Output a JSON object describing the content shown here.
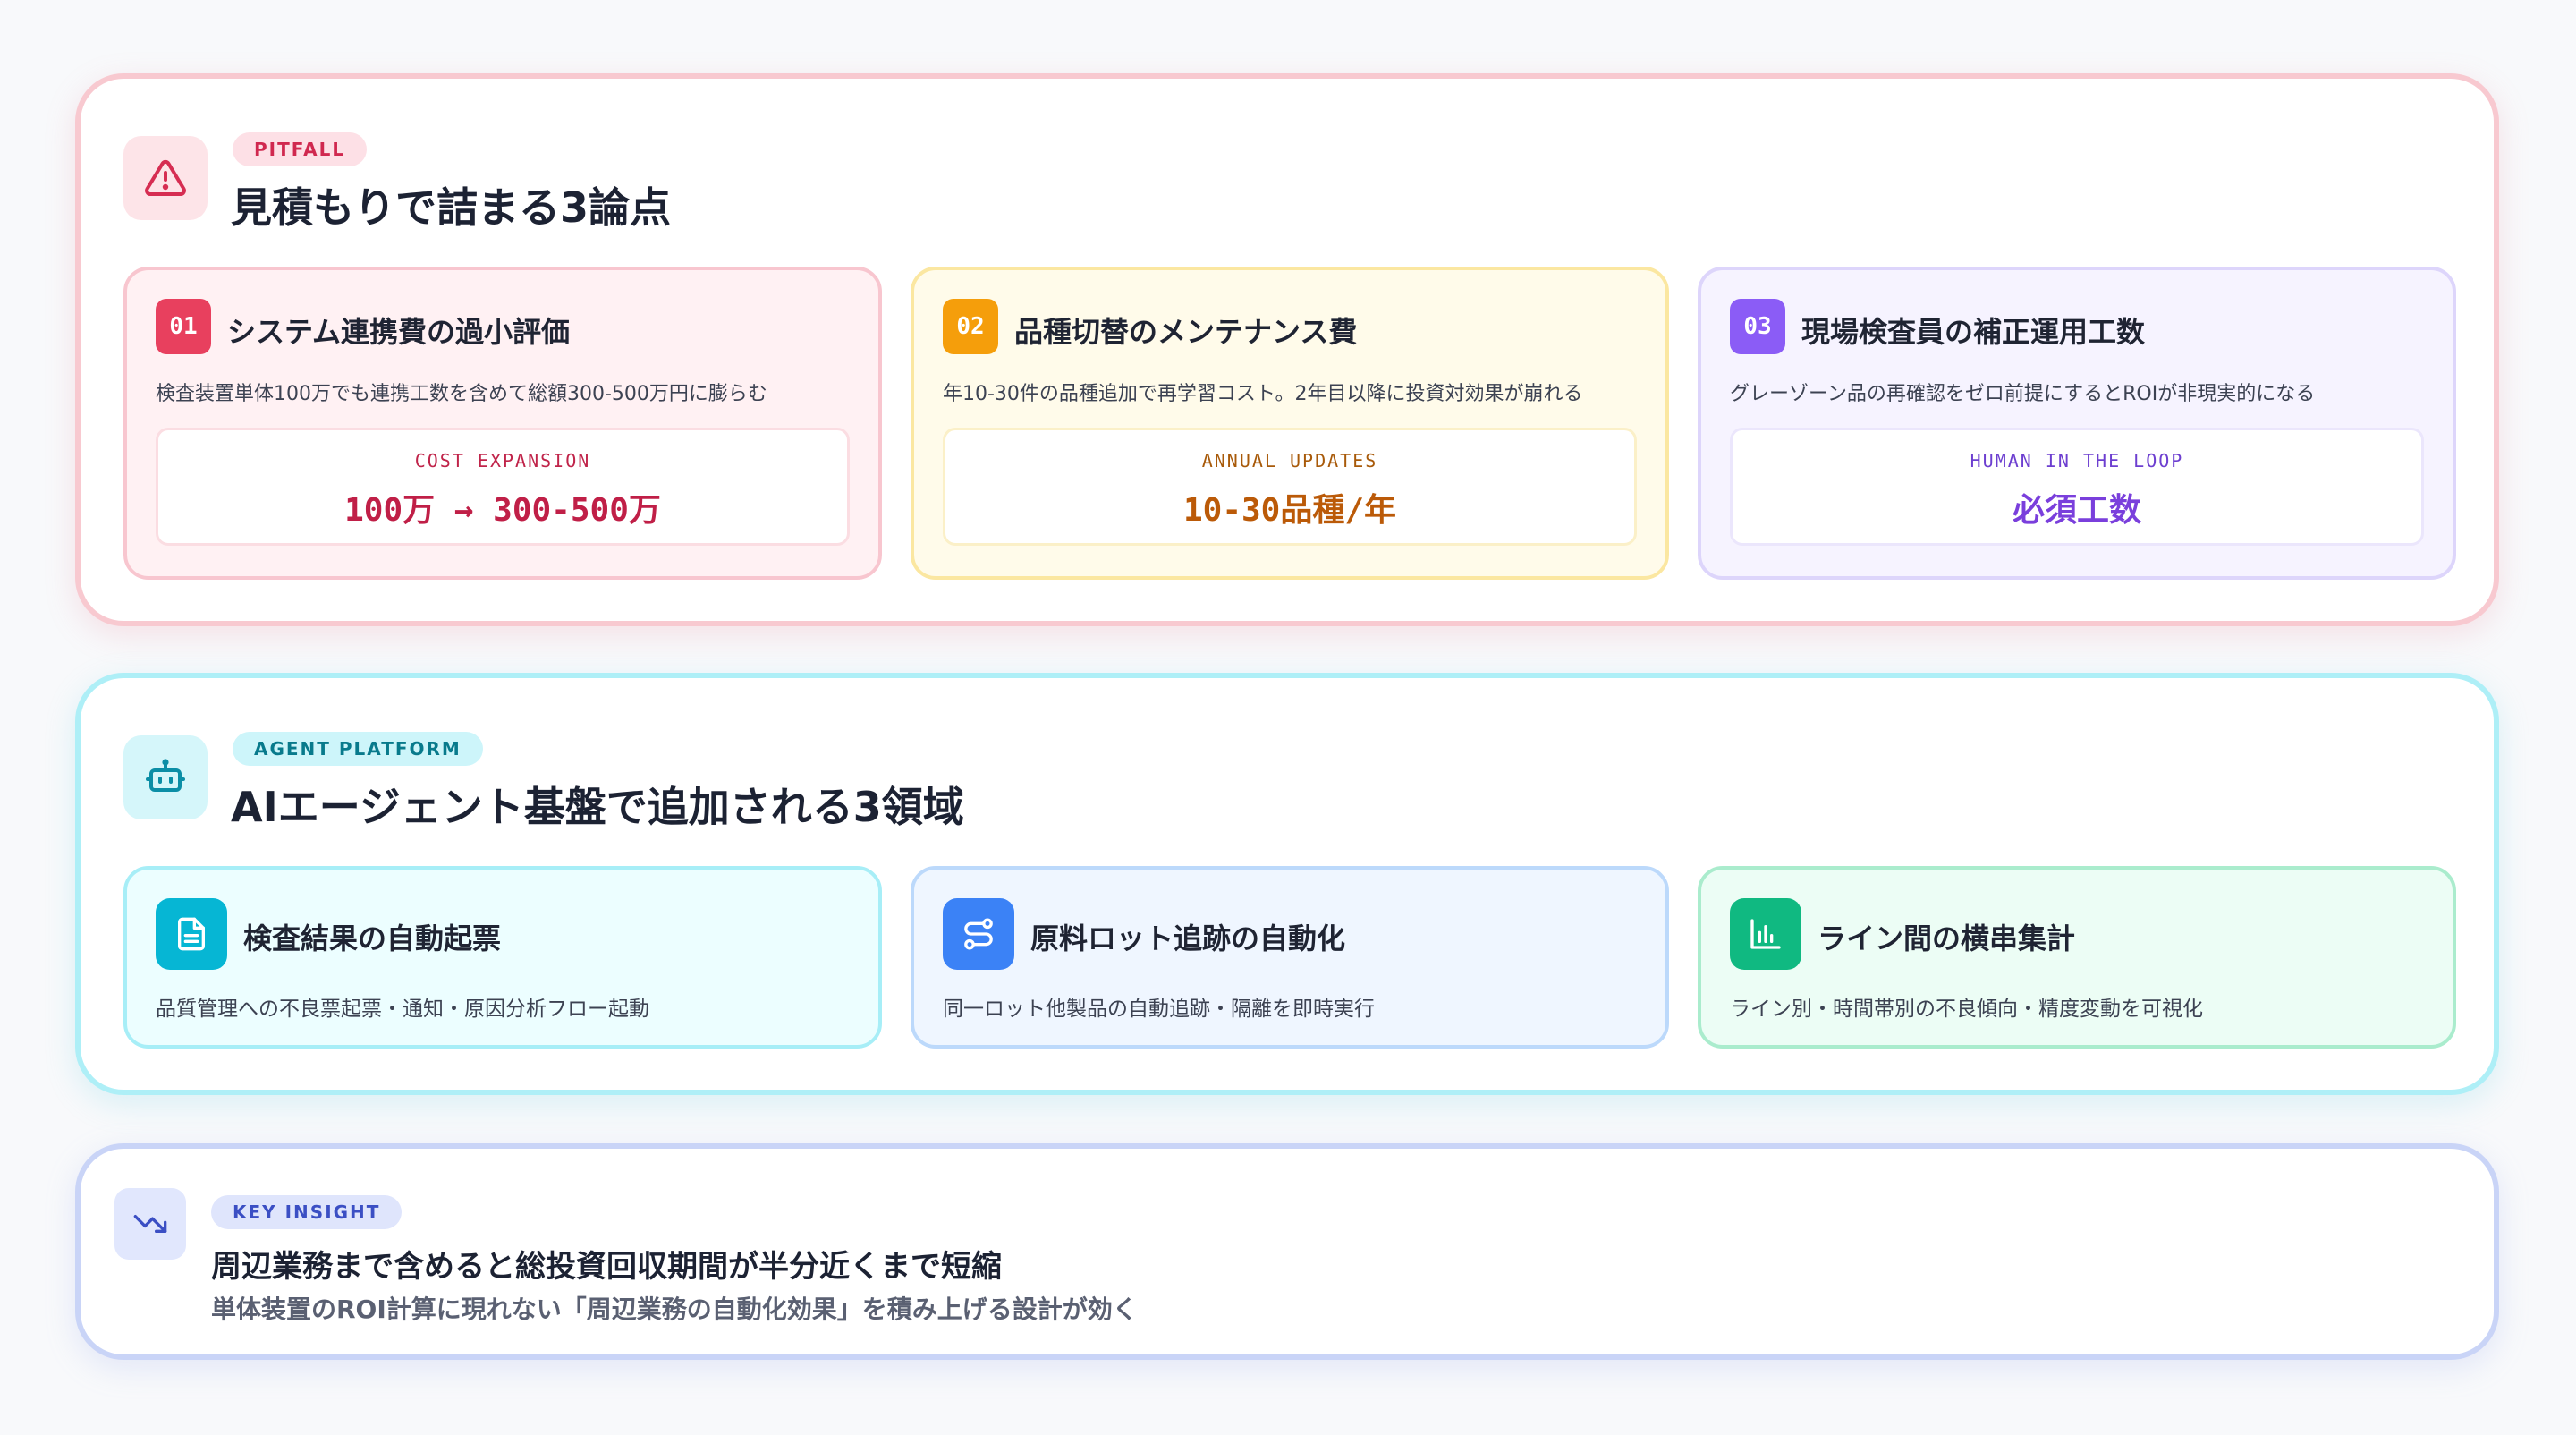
{
  "pitfall": {
    "badge": "PITFALL",
    "title": "見積もりで詰まる3論点",
    "icon": "warning-icon",
    "cards": [
      {
        "num": "01",
        "title": "システム連携費の過小評価",
        "desc": "検査装置単体100万でも連携工数を含めて総額300-500万円に膨らむ",
        "stat_label": "COST EXPANSION",
        "stat_value": "100万 → 300-500万"
      },
      {
        "num": "02",
        "title": "品種切替のメンテナンス費",
        "desc": "年10-30件の品種追加で再学習コスト。2年目以降に投資対効果が崩れる",
        "stat_label": "ANNUAL UPDATES",
        "stat_value": "10-30品種/年"
      },
      {
        "num": "03",
        "title": "現場検査員の補正運用工数",
        "desc": "グレーゾーン品の再確認をゼロ前提にするとROIが非現実的になる",
        "stat_label": "HUMAN IN THE LOOP",
        "stat_value": "必須工数"
      }
    ]
  },
  "agent": {
    "badge": "AGENT PLATFORM",
    "title": "AIエージェント基盤で追加される3領域",
    "icon": "robot-icon",
    "cards": [
      {
        "icon": "document-icon",
        "title": "検査結果の自動起票",
        "desc": "品質管理への不良票起票・通知・原因分析フロー起動"
      },
      {
        "icon": "route-icon",
        "title": "原料ロット追跡の自動化",
        "desc": "同一ロット他製品の自動追跡・隔離を即時実行"
      },
      {
        "icon": "bar-chart-icon",
        "title": "ライン間の横串集計",
        "desc": "ライン別・時間帯別の不良傾向・精度変動を可視化"
      }
    ]
  },
  "insight": {
    "badge": "KEY INSIGHT",
    "icon": "trending-down-icon",
    "title": "周辺業務まで含めると総投資回収期間が半分近くまで短縮",
    "desc": "単体装置のROI計算に現れない「周辺業務の自動化効果」を積み上げる設計が効く"
  },
  "colors": {
    "pitfall_accent": "#e0335a",
    "pitfall_badge_bg": "#fde0e6",
    "agent_accent": "#0aa5c0",
    "agent_badge_bg": "#cdf5fa",
    "insight_accent": "#3b4fc4",
    "insight_badge_bg": "#dfe5fc",
    "card1": "#e8405e",
    "card2": "#f59e0b",
    "card3": "#8b5cf6",
    "feature1": "#06b6d4",
    "feature2": "#3b82f6",
    "feature3": "#10b981"
  }
}
